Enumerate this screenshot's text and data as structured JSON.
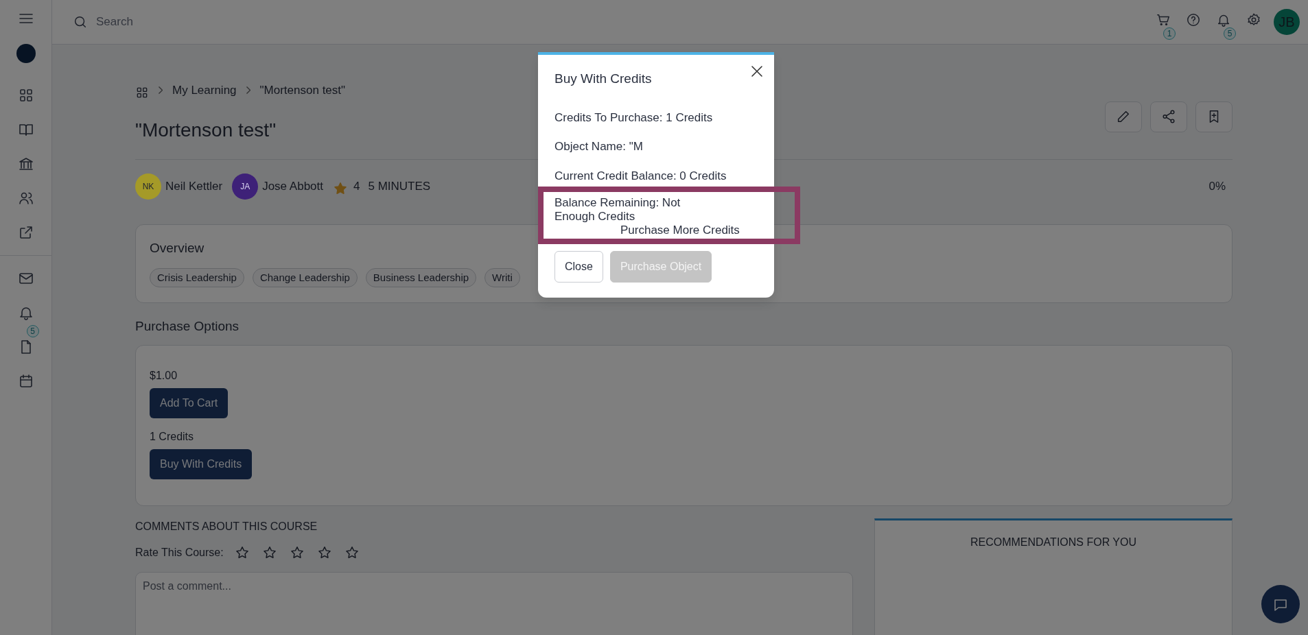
{
  "sidebar": {
    "notification_badge": "5"
  },
  "topbar": {
    "search": {
      "placeholder": "Search"
    },
    "cart_badge": "1",
    "notification_badge": "5",
    "avatar": "JB"
  },
  "breadcrumb": [
    "My Learning",
    "\"Mortenson test\""
  ],
  "title": "\"Mortenson test\"",
  "meta": {
    "authors": [
      {
        "initials": "NK",
        "name": "Neil Kettler",
        "color": "#a59a28"
      },
      {
        "initials": "JA",
        "name": "Jose Abbott",
        "color": "#3e2178"
      }
    ],
    "rating": "4",
    "duration": "5 MINUTES",
    "progress": "0%"
  },
  "overview": {
    "title": "Overview",
    "tags": [
      "Crisis Leadership",
      "Change Leadership",
      "Business Leadership",
      "Writi"
    ]
  },
  "purchase": {
    "title": "Purchase Options",
    "options": [
      {
        "price": "$1.00",
        "button": "Add To Cart"
      },
      {
        "price": "1 Credits",
        "button": "Buy With Credits"
      }
    ]
  },
  "comments": {
    "title": "COMMENTS ABOUT THIS COURSE",
    "rate_label": "Rate This Course:",
    "stars": 0,
    "placeholder": "Post a comment..."
  },
  "recommendations": {
    "title": "RECOMMENDATIONS FOR YOU"
  },
  "modal": {
    "title": "Buy With Credits",
    "lines": [
      "Credits To Purchase: 1 Credits",
      "Object Name: \"M",
      "Current Credit Balance: 0 Credits"
    ],
    "balance": "Balance Remaining: Not Enough Credits",
    "link": "Purchase More Credits",
    "buttons": [
      {
        "label": "Close",
        "kind": "outline",
        "disabled": false
      },
      {
        "label": "Purchase Object",
        "kind": "primary",
        "disabled": true
      }
    ]
  }
}
